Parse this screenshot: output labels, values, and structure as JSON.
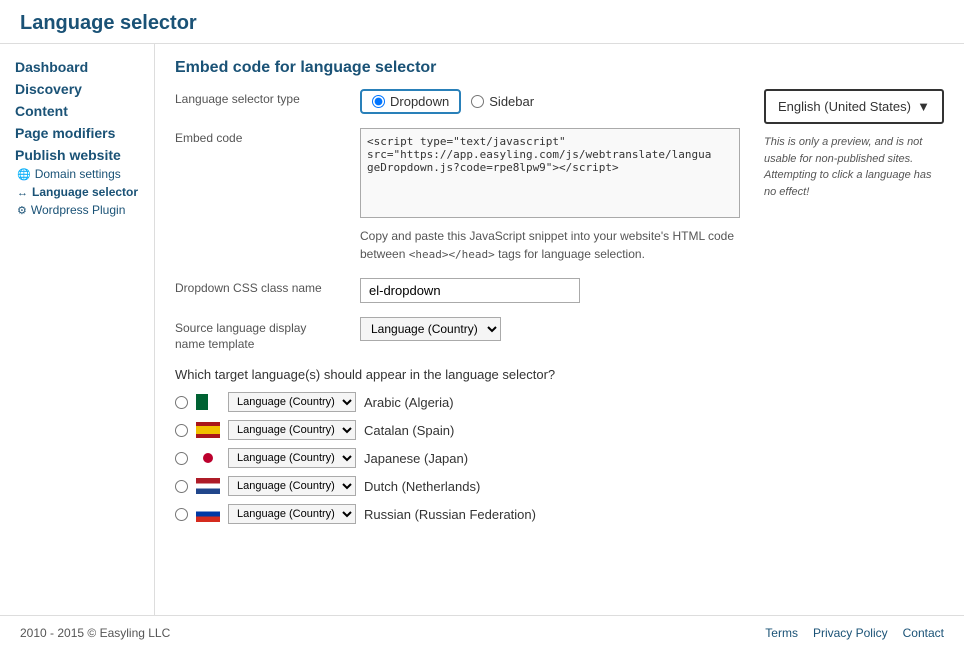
{
  "header": {
    "title": "Language selector"
  },
  "sidebar": {
    "items": [
      {
        "label": "Dashboard",
        "id": "dashboard"
      },
      {
        "label": "Discovery",
        "id": "discovery"
      },
      {
        "label": "Content",
        "id": "content"
      },
      {
        "label": "Page modifiers",
        "id": "page-modifiers"
      },
      {
        "label": "Publish website",
        "id": "publish-website"
      }
    ],
    "sub_items": [
      {
        "label": "Domain settings",
        "icon": "globe",
        "id": "domain-settings"
      },
      {
        "label": "Language selector",
        "icon": "arrows",
        "id": "language-selector",
        "active": true
      },
      {
        "label": "Wordpress Plugin",
        "icon": "wp",
        "id": "wordpress-plugin"
      }
    ]
  },
  "content": {
    "section_title": "Embed code for language selector",
    "language_selector_type_label": "Language selector type",
    "radio_options": [
      {
        "label": "Dropdown",
        "value": "dropdown",
        "selected": true
      },
      {
        "label": "Sidebar",
        "value": "sidebar",
        "selected": false
      }
    ],
    "embed_code_label": "Embed code",
    "embed_code_value": "<script type=\"text/javascript\"\nsrc=\"https://app.easyling.com/js/webtranslate/langua\ngeDropdown.js?code=rpe8lpw9\"></script>",
    "embed_help_text": "Copy and paste this JavaScript snippet into your website's HTML code between",
    "embed_help_tags": "<head></head>",
    "embed_help_suffix": "tags for language selection.",
    "css_class_label": "Dropdown CSS class name",
    "css_class_value": "el-dropdown",
    "source_lang_label": "Source language display\nname template",
    "source_lang_select": "Language (Country) ▼",
    "languages_question": "Which target language(s) should appear in the language selector?",
    "languages": [
      {
        "name": "Arabic (Algeria)",
        "template": "Language (Country)",
        "flag": "dz"
      },
      {
        "name": "Catalan (Spain)",
        "template": "Language (Country)",
        "flag": "es"
      },
      {
        "name": "Japanese (Japan)",
        "template": "Language (Country)",
        "flag": "jp"
      },
      {
        "name": "Dutch (Netherlands)",
        "template": "Language (Country)",
        "flag": "nl"
      },
      {
        "name": "Russian (Russian Federation)",
        "template": "Language (Country)",
        "flag": "ru"
      }
    ]
  },
  "preview": {
    "dropdown_text": "English (United States)",
    "dropdown_arrow": "▼",
    "note": "This is only a preview, and is not usable for non-published sites. Attempting to click a language has no effect!"
  },
  "footer": {
    "copyright": "2010 - 2015 © Easyling LLC",
    "links": [
      {
        "label": "Terms"
      },
      {
        "label": "Privacy Policy"
      },
      {
        "label": "Contact"
      }
    ]
  }
}
